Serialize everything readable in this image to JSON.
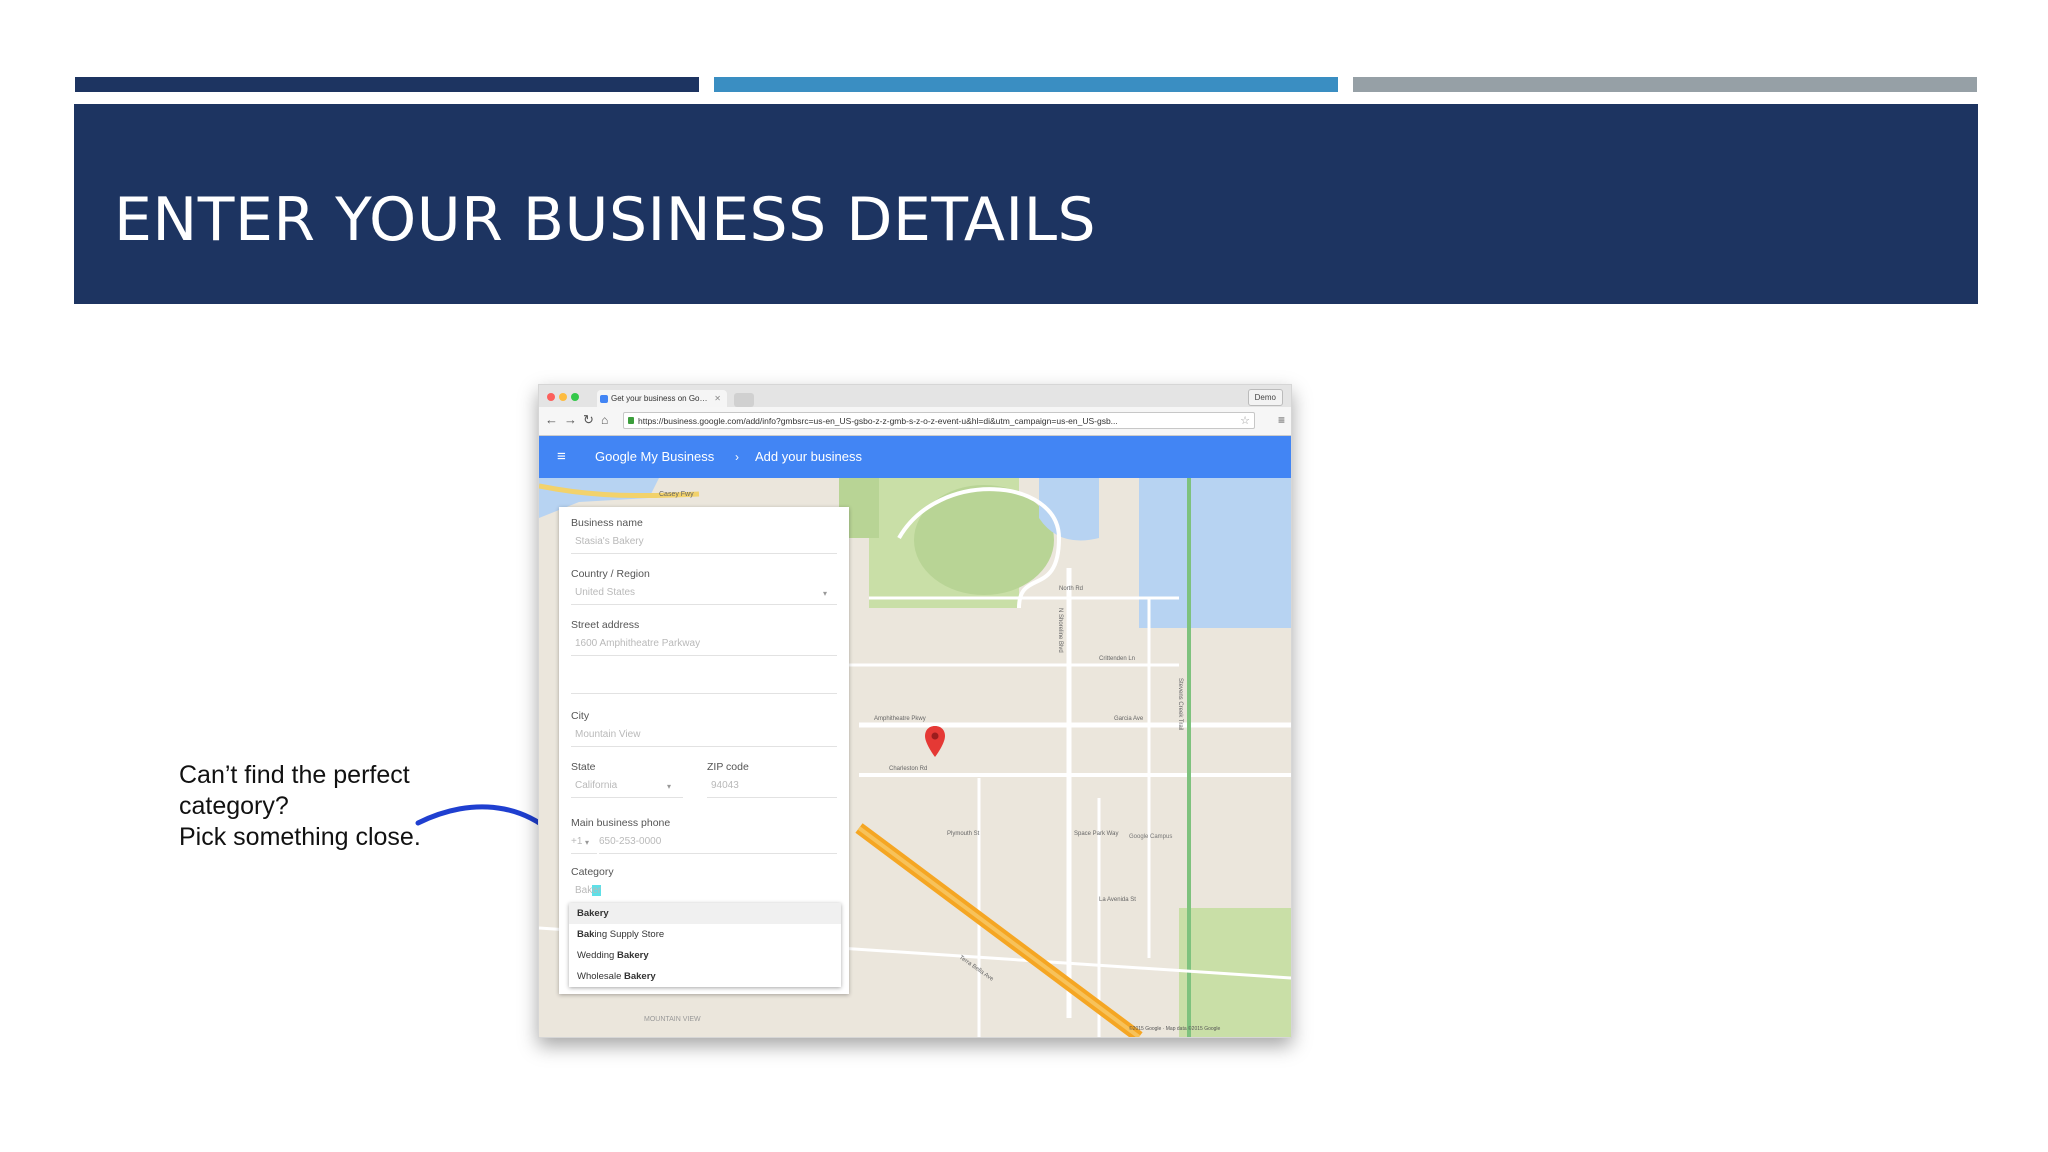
{
  "slide": {
    "title": "ENTER YOUR BUSINESS DETAILS",
    "accent_colors": [
      "#1d3461",
      "#3a8ec2",
      "#96a0a6"
    ],
    "caption_lines": [
      "Can’t find the perfect",
      "category?",
      "Pick something close."
    ],
    "arrow_color": "#1f3fd0"
  },
  "browser": {
    "tab_title": "Get your business on Go…",
    "profile_label": "Demo",
    "url": "https://business.google.com/add/info?gmbsrc=us-en_US-gsbo-z-z-gmb-s-z-o-z-event-u&hl=di&utm_campaign=us-en_US-gsb...",
    "nav_icons": [
      "back-arrow-icon",
      "forward-arrow-icon",
      "reload-icon",
      "home-icon"
    ],
    "app_color": "#4285f4",
    "breadcrumb": [
      "Google My Business",
      "Add your business"
    ]
  },
  "form": {
    "business_name": {
      "label": "Business name",
      "value": "Stasia's Bakery"
    },
    "country": {
      "label": "Country / Region",
      "value": "United States"
    },
    "street": {
      "label": "Street address",
      "value": "1600 Amphitheatre Parkway"
    },
    "city": {
      "label": "City",
      "value": "Mountain View"
    },
    "state": {
      "label": "State",
      "value": "California"
    },
    "zip": {
      "label": "ZIP code",
      "value": "94043"
    },
    "phone": {
      "label": "Main business phone",
      "prefix": "+1",
      "value": "650-253-0000"
    },
    "category": {
      "label": "Category",
      "typed": "Bak",
      "typed_highlight": "er"
    },
    "suggestions": [
      {
        "bold": "Bakery",
        "rest": ""
      },
      {
        "bold": "Bak",
        "rest": "ing Supply Store"
      },
      {
        "pre": "Wedding ",
        "bold": "Bakery"
      },
      {
        "pre": "Wholesale ",
        "bold": "Bakery"
      }
    ]
  },
  "map": {
    "labels": [
      "Casey Fwy",
      "N Shoreline Blvd",
      "North Rd",
      "Amphitheatre Pkwy",
      "Charleston Rd",
      "Crittenden Ln",
      "Garcia Ave",
      "Space Park Way",
      "Plymouth St",
      "La Avenida St",
      "Terra Bella Ave",
      "Stevens Creek Trail",
      "Google Campus",
      "MOUNTAIN VIEW",
      "©2015 Google · Map data ©2015 Google"
    ],
    "pin_color": "#e53935"
  }
}
